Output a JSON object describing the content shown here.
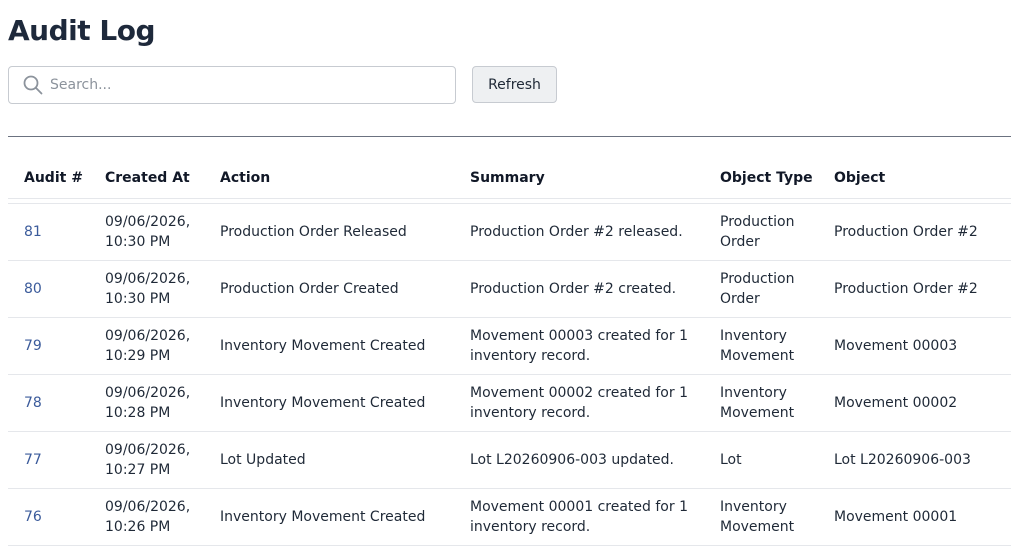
{
  "page": {
    "title": "Audit Log"
  },
  "search": {
    "placeholder": "Search...",
    "value": ""
  },
  "toolbar": {
    "refresh_label": "Refresh"
  },
  "table": {
    "columns": [
      "Audit #",
      "Created At",
      "Action",
      "Summary",
      "Object Type",
      "Object"
    ],
    "rows": [
      {
        "id": "81",
        "created_line1": "09/06/2026,",
        "created_line2": "10:30 PM",
        "action": "Production Order Released",
        "summary": "Production Order #2 released.",
        "object_type": "Production\nOrder",
        "object": "Production Order #2"
      },
      {
        "id": "80",
        "created_line1": "09/06/2026,",
        "created_line2": "10:30 PM",
        "action": "Production Order Created",
        "summary": "Production Order #2 created.",
        "object_type": "Production\nOrder",
        "object": "Production Order #2"
      },
      {
        "id": "79",
        "created_line1": "09/06/2026,",
        "created_line2": "10:29 PM",
        "action": "Inventory Movement Created",
        "summary": "Movement 00003 created for 1\ninventory record.",
        "object_type": "Inventory\nMovement",
        "object": "Movement 00003"
      },
      {
        "id": "78",
        "created_line1": "09/06/2026,",
        "created_line2": "10:28 PM",
        "action": "Inventory Movement Created",
        "summary": "Movement 00002 created for 1\ninventory record.",
        "object_type": "Inventory\nMovement",
        "object": "Movement 00002"
      },
      {
        "id": "77",
        "created_line1": "09/06/2026,",
        "created_line2": "10:27 PM",
        "action": "Lot Updated",
        "summary": "Lot L20260906-003 updated.",
        "object_type": "Lot",
        "object": "Lot L20260906-003"
      },
      {
        "id": "76",
        "created_line1": "09/06/2026,",
        "created_line2": "10:26 PM",
        "action": "Inventory Movement Created",
        "summary": "Movement 00001 created for 1\ninventory record.",
        "object_type": "Inventory\nMovement",
        "object": "Movement 00001"
      }
    ]
  },
  "colors": {
    "link": "#3b5b9b",
    "title": "#1e293b"
  },
  "icons": {
    "search": "search-icon"
  }
}
